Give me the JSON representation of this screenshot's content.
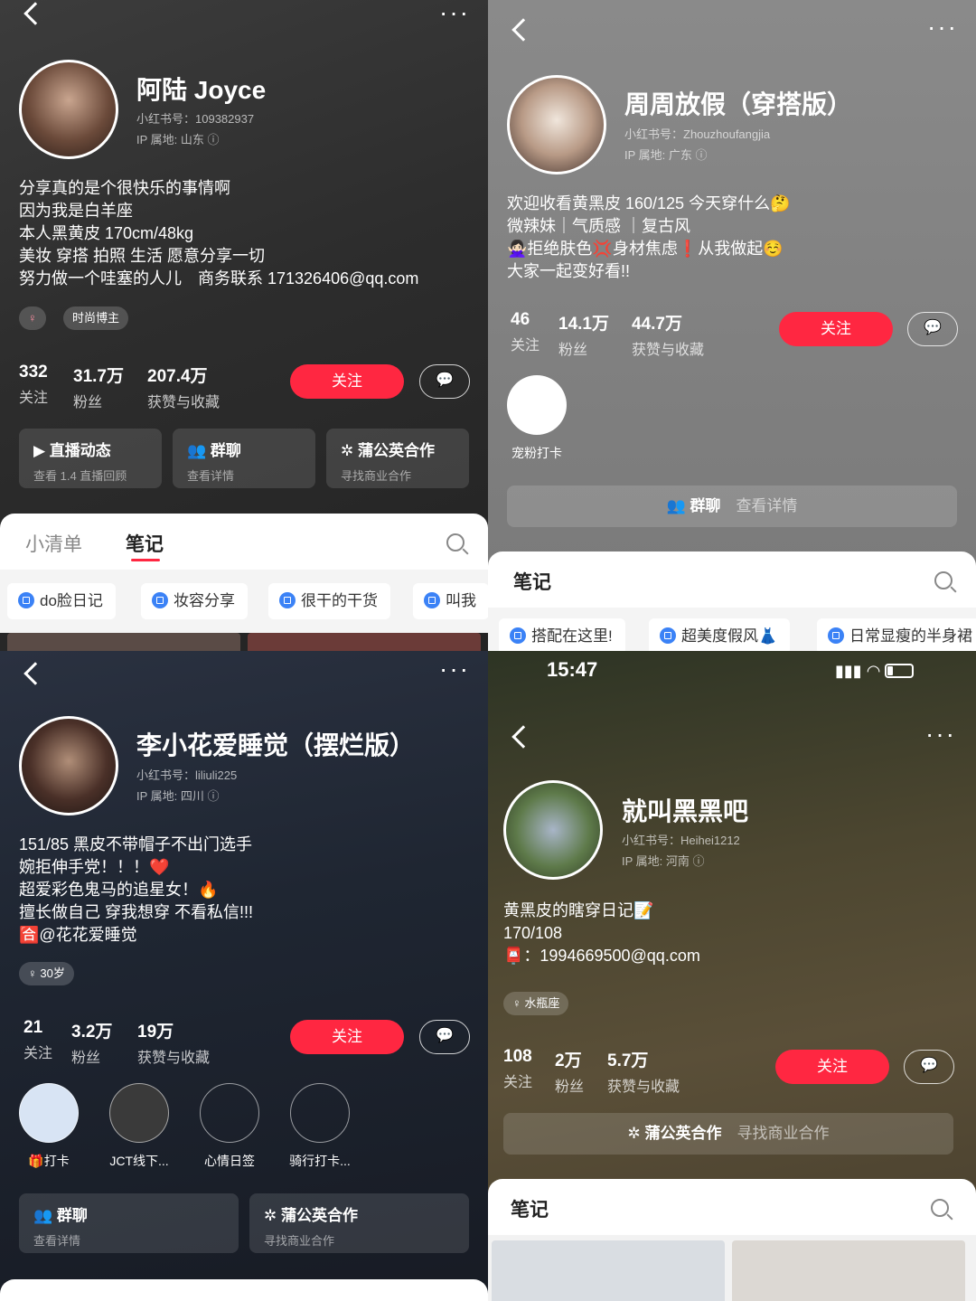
{
  "p1": {
    "name": "阿陆 Joyce",
    "id": "小红书号：109382937",
    "ip": "IP 属地: 山东 ⓘ",
    "bio": [
      "分享真的是个很快乐的事情啊",
      "因为我是白羊座",
      "本人黑黄皮 170cm/48kg",
      "美妆 穿搭 拍照 生活 愿意分享一切",
      "努力做一个哇塞的人儿　商务联系 171326406@qq.com"
    ],
    "tags": [
      "♀",
      "时尚博主"
    ],
    "stats": [
      {
        "n": "332",
        "l": "关注"
      },
      {
        "n": "31.7万",
        "l": "粉丝"
      },
      {
        "n": "207.4万",
        "l": "获赞与收藏"
      }
    ],
    "follow": "关注",
    "cards": [
      {
        "t": "直播动态",
        "s": "查看 1.4 直播回顾"
      },
      {
        "t": "群聊",
        "s": "查看详情"
      },
      {
        "t": "蒲公英合作",
        "s": "寻找商业合作"
      }
    ],
    "tabs": [
      "小清单",
      "笔记"
    ],
    "chips": [
      "do脸日记",
      "妆容分享",
      "很干的干货",
      "叫我"
    ]
  },
  "p2": {
    "name": "周周放假（穿搭版）",
    "id": "小红书号：Zhouzhoufangjia",
    "ip": "IP 属地: 广东 ⓘ",
    "bio": [
      "欢迎收看黄黑皮 160/125 今天穿什么🤔",
      "微辣妹｜气质感 ｜复古风",
      "🙅🏻‍♀️拒绝肤色💢身材焦虑❗️从我做起☺️",
      "大家一起变好看!!"
    ],
    "stats": [
      {
        "n": "46",
        "l": "关注"
      },
      {
        "n": "14.1万",
        "l": "粉丝"
      },
      {
        "n": "44.7万",
        "l": "获赞与收藏"
      }
    ],
    "follow": "关注",
    "highlight": "宠粉打卡",
    "group": "群聊",
    "group_sub": "查看详情",
    "tab": "笔记",
    "chips": [
      "搭配在这里!",
      "超美度假风👗",
      "日常显瘦的半身裙"
    ]
  },
  "p3": {
    "name": "李小花爱睡觉（摆烂版）",
    "id": "小红书号：liliuli225",
    "ip": "IP 属地: 四川 ⓘ",
    "bio": [
      "151/85 黑皮不带帽子不出门选手",
      "婉拒伸手党！！！❤️",
      "超爱彩色鬼马的追星女！🔥",
      "擅长做自己 穿我想穿 不看私信!!!",
      "🈴@花花爱睡觉"
    ],
    "tag": "♀ 30岁",
    "stats": [
      {
        "n": "21",
        "l": "关注"
      },
      {
        "n": "3.2万",
        "l": "粉丝"
      },
      {
        "n": "19万",
        "l": "获赞与收藏"
      }
    ],
    "follow": "关注",
    "highlights": [
      "🎁打卡",
      "JCT线下...",
      "心情日签",
      "骑行打卡..."
    ],
    "cards": [
      {
        "t": "群聊",
        "s": "查看详情"
      },
      {
        "t": "蒲公英合作",
        "s": "寻找商业合作"
      }
    ]
  },
  "p4": {
    "time": "15:47",
    "name": "就叫黑黑吧",
    "id": "小红书号：Heihei1212",
    "ip": "IP 属地: 河南 ⓘ",
    "bio": [
      "黄黑皮的瞎穿日记📝",
      "170/108",
      "📮：1994669500@qq.com"
    ],
    "tag": "♀ 水瓶座",
    "stats": [
      {
        "n": "108",
        "l": "关注"
      },
      {
        "n": "2万",
        "l": "粉丝"
      },
      {
        "n": "5.7万",
        "l": "获赞与收藏"
      }
    ],
    "follow": "关注",
    "coop": "蒲公英合作",
    "coop_sub": "寻找商业合作",
    "tab": "笔记"
  },
  "colors": {
    "accent": "#ff2741"
  }
}
